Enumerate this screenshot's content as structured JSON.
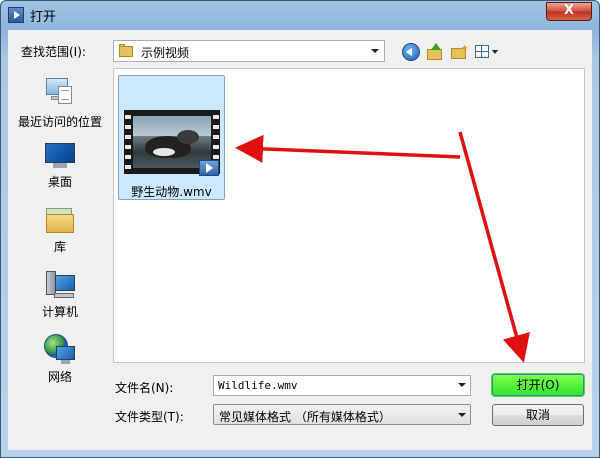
{
  "window": {
    "title": "打开",
    "close_label": "X"
  },
  "toolbar": {
    "lookin_label": "查找范围(I):",
    "lookin_value": "示例视频",
    "icons": [
      "back-icon",
      "up-folder-icon",
      "new-folder-icon",
      "view-menu-icon"
    ]
  },
  "places": [
    {
      "label": "最近访问的位置",
      "icon": "recent-places-icon"
    },
    {
      "label": "桌面",
      "icon": "desktop-icon"
    },
    {
      "label": "库",
      "icon": "libraries-icon"
    },
    {
      "label": "计算机",
      "icon": "computer-icon"
    },
    {
      "label": "网络",
      "icon": "network-icon"
    }
  ],
  "files": [
    {
      "name": "野生动物.wmv",
      "selected": true,
      "icon": "video-thumbnail"
    }
  ],
  "filename": {
    "label": "文件名(N):",
    "value": "Wildlife.wmv"
  },
  "filetype": {
    "label": "文件类型(T):",
    "value": "常见媒体格式 （所有媒体格式）"
  },
  "buttons": {
    "open": "打开(O)",
    "cancel": "取消"
  },
  "colors": {
    "annotation_arrow": "#e01010",
    "open_highlight": "#2fe82a",
    "selection": "#cce8ff"
  }
}
